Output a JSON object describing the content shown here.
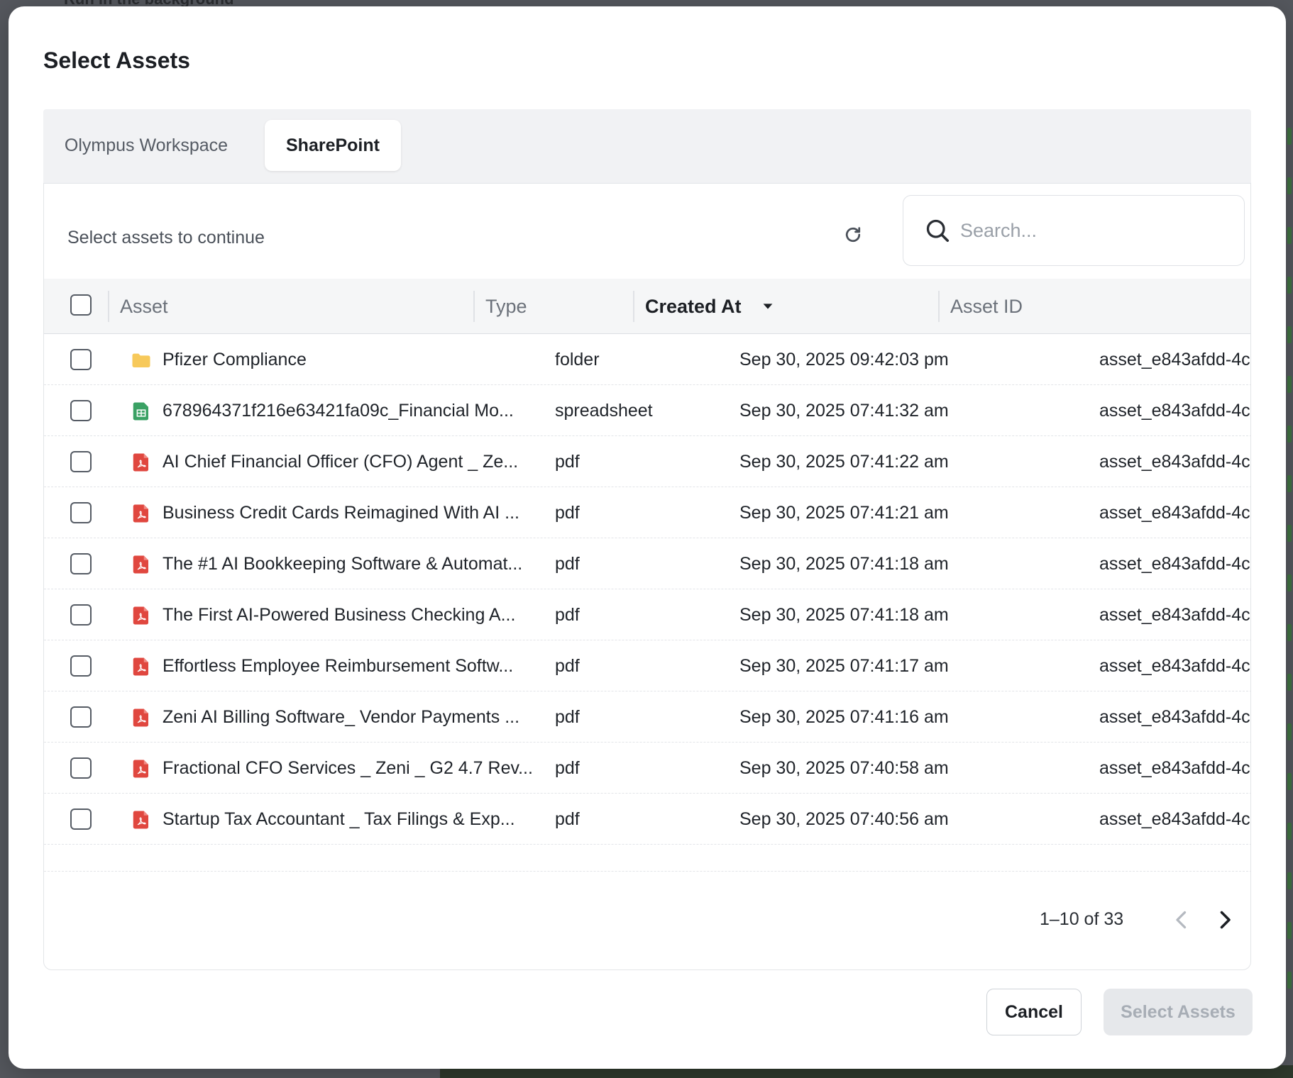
{
  "background": {
    "top_text": "Run in the background"
  },
  "modal": {
    "title": "Select Assets"
  },
  "tabs": [
    {
      "label": "Olympus Workspace",
      "active": false
    },
    {
      "label": "SharePoint",
      "active": true
    }
  ],
  "toolbar": {
    "label": "Select assets to continue",
    "refresh_icon": "refresh-icon",
    "search_placeholder": "Search...",
    "search_value": ""
  },
  "table": {
    "columns": {
      "asset": "Asset",
      "type": "Type",
      "created_at": "Created At",
      "asset_id": "Asset ID"
    },
    "sort": {
      "column": "created_at",
      "direction": "desc"
    },
    "rows": [
      {
        "icon": "folder-icon",
        "name": "Pfizer Compliance",
        "type": "folder",
        "created_at": "Sep 30, 2025 09:42:03 pm",
        "asset_id": "asset_e843afdd-4c"
      },
      {
        "icon": "spreadsheet-icon",
        "name": "678964371f216e63421fa09c_Financial Mo...",
        "type": "spreadsheet",
        "created_at": "Sep 30, 2025 07:41:32 am",
        "asset_id": "asset_e843afdd-4c"
      },
      {
        "icon": "pdf-icon",
        "name": "AI Chief Financial Officer (CFO) Agent _ Ze...",
        "type": "pdf",
        "created_at": "Sep 30, 2025 07:41:22 am",
        "asset_id": "asset_e843afdd-4c"
      },
      {
        "icon": "pdf-icon",
        "name": "Business Credit Cards Reimagined With AI ...",
        "type": "pdf",
        "created_at": "Sep 30, 2025 07:41:21 am",
        "asset_id": "asset_e843afdd-4c"
      },
      {
        "icon": "pdf-icon",
        "name": "The #1 AI Bookkeeping Software & Automat...",
        "type": "pdf",
        "created_at": "Sep 30, 2025 07:41:18 am",
        "asset_id": "asset_e843afdd-4c"
      },
      {
        "icon": "pdf-icon",
        "name": "The First AI-Powered Business Checking A...",
        "type": "pdf",
        "created_at": "Sep 30, 2025 07:41:18 am",
        "asset_id": "asset_e843afdd-4c"
      },
      {
        "icon": "pdf-icon",
        "name": "Effortless Employee Reimbursement Softw...",
        "type": "pdf",
        "created_at": "Sep 30, 2025 07:41:17 am",
        "asset_id": "asset_e843afdd-4c"
      },
      {
        "icon": "pdf-icon",
        "name": "Zeni AI Billing Software_ Vendor Payments ...",
        "type": "pdf",
        "created_at": "Sep 30, 2025 07:41:16 am",
        "asset_id": "asset_e843afdd-4c"
      },
      {
        "icon": "pdf-icon",
        "name": "Fractional CFO Services _ Zeni _ G2 4.7 Rev...",
        "type": "pdf",
        "created_at": "Sep 30, 2025 07:40:58 am",
        "asset_id": "asset_e843afdd-4c"
      },
      {
        "icon": "pdf-icon",
        "name": "Startup Tax Accountant _ Tax Filings & Exp...",
        "type": "pdf",
        "created_at": "Sep 30, 2025 07:40:56 am",
        "asset_id": "asset_e843afdd-4c"
      }
    ]
  },
  "pagination": {
    "label": "1–10 of 33",
    "prev_enabled": false,
    "next_enabled": true
  },
  "footer": {
    "cancel_label": "Cancel",
    "select_label": "Select Assets",
    "select_enabled": false
  },
  "colors": {
    "folder": "#f7c95a",
    "spreadsheet": "#3aa164",
    "pdf": "#e0473f",
    "disabled_button_bg": "#e6e8eb"
  }
}
